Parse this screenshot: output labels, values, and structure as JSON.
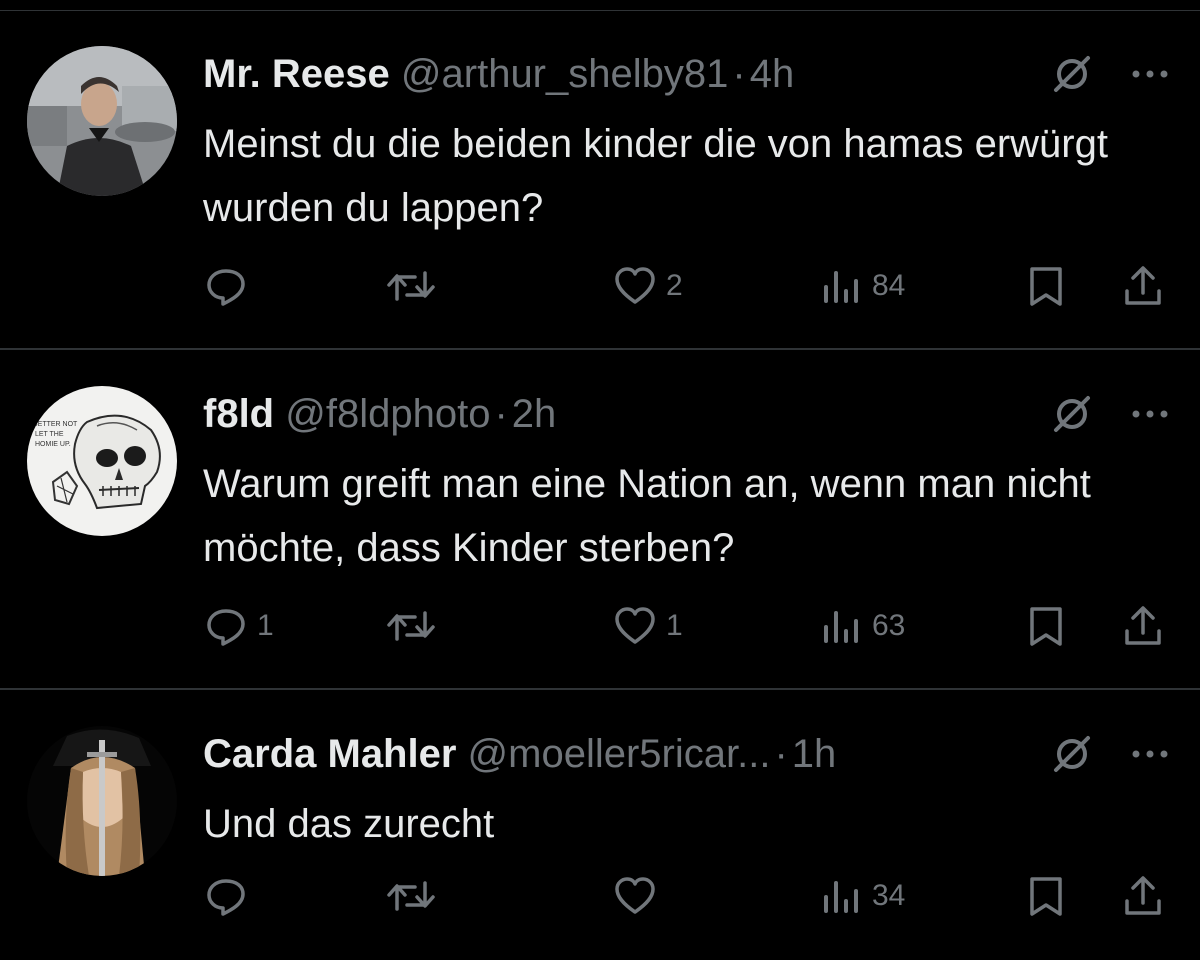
{
  "tweets": [
    {
      "name": "Mr. Reese",
      "handle": "@arthur_shelby81",
      "separator": "·",
      "time": "4h",
      "text": "Meinst du die beiden kinder die von hamas erwürgt wurden du lappen?",
      "replies": "",
      "retweets": "",
      "likes": "2",
      "views": "84"
    },
    {
      "name": "f8ld",
      "handle": "@f8ldphoto",
      "separator": "·",
      "time": "2h",
      "text": "Warum greift man eine Nation an, wenn man nicht möchte, dass Kinder sterben?",
      "replies": "1",
      "retweets": "",
      "likes": "1",
      "views": "63"
    },
    {
      "name": "Carda Mahler",
      "handle": "@moeller5ricar...",
      "separator": "·",
      "time": "1h",
      "text": "Und das zurecht",
      "replies": "",
      "retweets": "",
      "likes": "",
      "views": "34"
    }
  ],
  "icons": {
    "grok": "grok-icon",
    "more": "more-icon",
    "reply": "reply-icon",
    "retweet": "retweet-icon",
    "like": "heart-icon",
    "views": "views-icon",
    "bookmark": "bookmark-icon",
    "share": "share-icon"
  },
  "colors": {
    "background": "#000000",
    "text": "#e7e9ea",
    "secondary": "#71767b",
    "divider": "#2f3336"
  }
}
